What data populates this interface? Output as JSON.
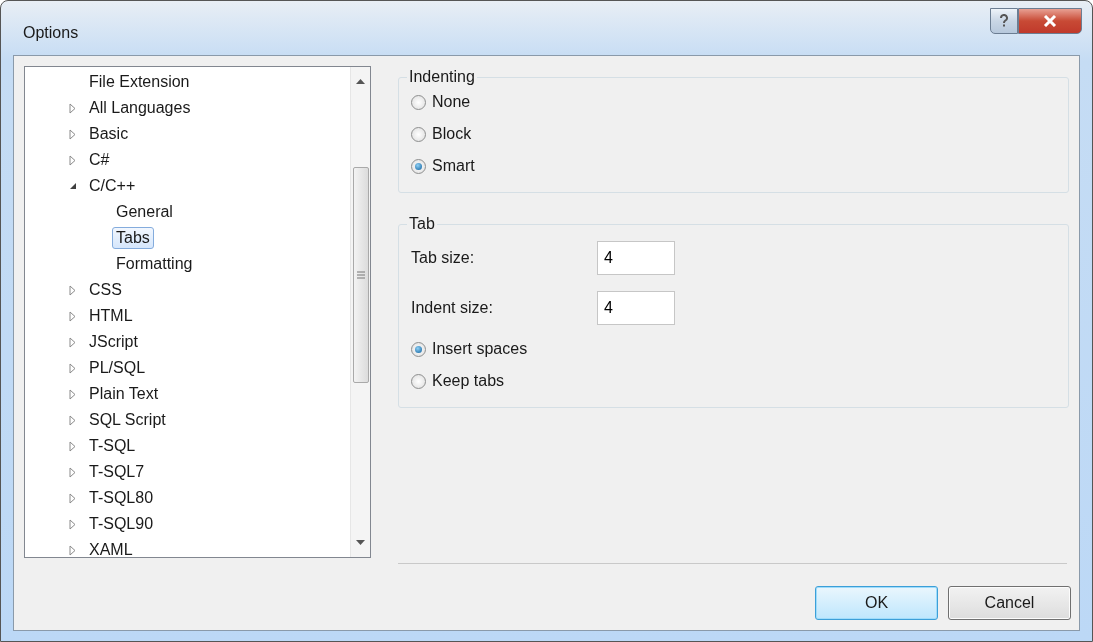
{
  "window": {
    "title": "Options"
  },
  "tree": [
    {
      "label": "File Extension",
      "selected": false
    },
    {
      "label": "All Languages",
      "selected": false,
      "expanded": false
    },
    {
      "label": "Basic",
      "selected": false,
      "expanded": false
    },
    {
      "label": "C#",
      "selected": false,
      "expanded": false
    },
    {
      "label": "C/C++",
      "selected": false,
      "expanded": true,
      "children": [
        {
          "label": "General",
          "selected": false
        },
        {
          "label": "Tabs",
          "selected": true
        },
        {
          "label": "Formatting",
          "selected": false
        }
      ]
    },
    {
      "label": "CSS",
      "selected": false,
      "expanded": false
    },
    {
      "label": "HTML",
      "selected": false,
      "expanded": false
    },
    {
      "label": "JScript",
      "selected": false,
      "expanded": false
    },
    {
      "label": "PL/SQL",
      "selected": false,
      "expanded": false
    },
    {
      "label": "Plain Text",
      "selected": false,
      "expanded": false
    },
    {
      "label": "SQL Script",
      "selected": false,
      "expanded": false
    },
    {
      "label": "T-SQL",
      "selected": false,
      "expanded": false
    },
    {
      "label": "T-SQL7",
      "selected": false,
      "expanded": false
    },
    {
      "label": "T-SQL80",
      "selected": false,
      "expanded": false
    },
    {
      "label": "T-SQL90",
      "selected": false,
      "expanded": false
    },
    {
      "label": "XAML",
      "selected": false,
      "expanded": false
    }
  ],
  "indenting": {
    "title": "Indenting",
    "options": [
      {
        "label": "None",
        "selected": false
      },
      {
        "label": "Block",
        "selected": false
      },
      {
        "label": "Smart",
        "selected": true
      }
    ]
  },
  "tab": {
    "title": "Tab",
    "fields": [
      {
        "label": "Tab size:",
        "value": "4"
      },
      {
        "label": "Indent size:",
        "value": "4"
      }
    ],
    "options": [
      {
        "label": "Insert spaces",
        "selected": true
      },
      {
        "label": "Keep tabs",
        "selected": false
      }
    ]
  },
  "buttons": [
    {
      "label": "OK",
      "default": true
    },
    {
      "label": "Cancel",
      "default": false
    }
  ]
}
